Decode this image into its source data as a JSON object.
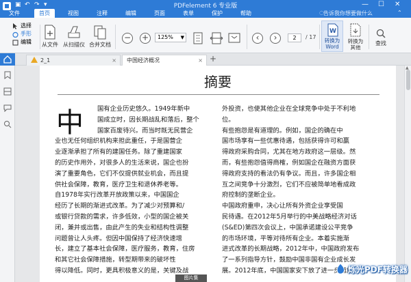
{
  "app": {
    "title": "PDFelement 6 专业版",
    "colors": {
      "accent": "#2e7bd6",
      "warning": "#e9a825"
    }
  },
  "menu": {
    "items": [
      "文件",
      "首页",
      "视图",
      "注释",
      "编辑",
      "页面",
      "表单",
      "保护",
      "帮助"
    ],
    "active": "首页",
    "tell_me_placeholder": "告诉我你想要做什么"
  },
  "ribbon": {
    "select_tools": [
      "选择",
      "手形",
      "编辑"
    ],
    "from_file": "从文件",
    "from_scanner": "从扫描仪",
    "combine_files": "合并文档",
    "zoom": "125%",
    "current_page": "2",
    "total_pages": "/ 17",
    "convert_to_word": "转换为\nWord",
    "convert_to_word_l1": "转换为",
    "convert_to_word_l2": "Word",
    "convert_to_other_l1": "转换为",
    "convert_to_other_l2": "其他",
    "search": "查找"
  },
  "tabs": [
    {
      "label": "2_1",
      "warning": true
    },
    {
      "label": "中国经济概况",
      "active": true
    }
  ],
  "document": {
    "title": "摘要",
    "dropcap": "中",
    "left_column": [
      "国有企业历史悠久。1949年新中",
      "国成立时，因长期战乱和落后，整个",
      "国家百废待兴。而当时既无民营企",
      "业也无任何组织机构来担此重任，于是国营企",
      "业逐渐承担了所有的建国任务。除了重建国家",
      "的历史作用外，对很多人的生活来说，国企也扮",
      "演了重要角色，它们不仅提供就业机会，而且提",
      "供社会保障，教育，医疗卫生和退休养老等。",
      "    自1978年实行改革开放政策以来，中国国企",
      "经历了长期的渐进式改革。为了减少对预算和/",
      "或银行贷款的需求，许多低效，小型的国企被关",
      "闭，兼并或出售，由此产生的失业和结构性调整",
      "问题曾让人头疼。但因中国保持了经济快速增",
      "长，建立了基本社会保障，医疗服务，教育，住房",
      "和其它社会保障措施，转型期带来的破坏性",
      "得以降低。同时，更具积极意义的是，关键及战"
    ],
    "right_column": [
      "外投资，也使其他企业在全球竞争中处于不利地",
      "位。",
      "    有些抱怨是有道理的。例如，国企的确在中",
      "国市场享有一些优惠待遇，包括获得许可和赢",
      "得政府采购合同，尤其在地方政府这一层级。然",
      "而，有些抱怨值得商榷，例如国企在融资方面获",
      "得政府支持的看法仍有争议。而且，许多国企相",
      "互之间竞争十分激烈，它们不应被简单地看成政",
      "府控制的垄断企业。",
      "    中国政府重申，决心让所有外资企业享受国",
      "民待遇。在2012年5月举行的中美战略经济对话",
      "(S&ED)第四次会议上，中国承诺建设公平竞争",
      "的市场环境，平等对待所有企业。本着实施渐",
      "进式改革的长期战略，2012年中，中国政府发布",
      "了一系列指导方针，鼓励中国非国有企业成长发",
      "展。2012年底，中国国家安下放了进一步措施"
    ],
    "bottom_tag": "图片集"
  },
  "watermark": {
    "text": "烁光PDF转换器"
  }
}
